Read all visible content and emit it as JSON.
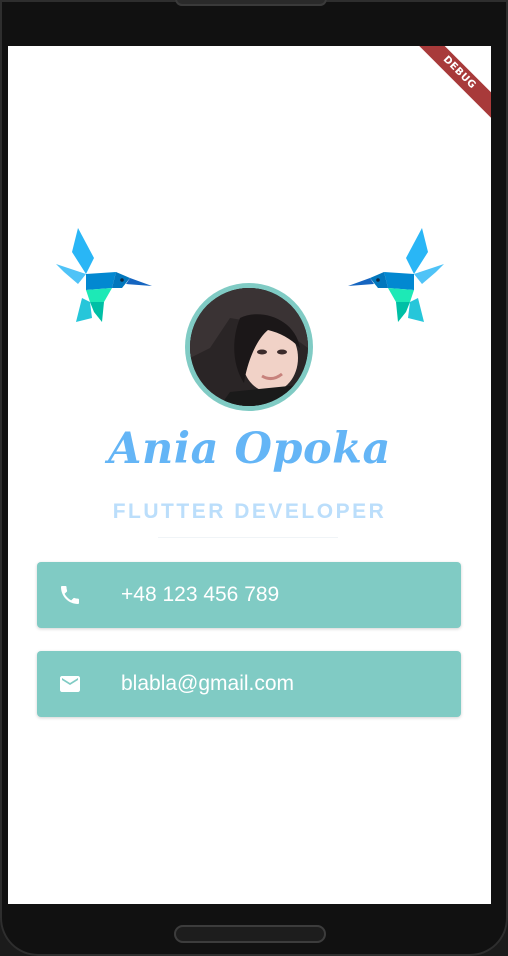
{
  "debug_banner": "DEBUG",
  "profile": {
    "name": "Ania Opoka",
    "role": "FLUTTER DEVELOPER"
  },
  "contacts": [
    {
      "icon": "phone-icon",
      "text": "+48 123 456 789"
    },
    {
      "icon": "mail-icon",
      "text": "blabla@gmail.com"
    }
  ],
  "colors": {
    "card": "#80cbc4",
    "name": "#64b5f6",
    "role": "#bbdefb",
    "avatar_ring": "#80cbc4",
    "ribbon": "#a83a3a"
  }
}
